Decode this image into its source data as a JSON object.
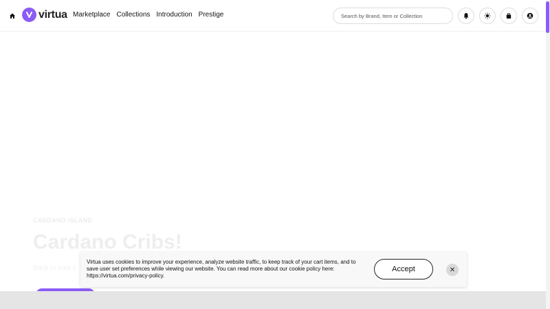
{
  "brand": {
    "name": "virtua",
    "accent": "#8b5cf6"
  },
  "nav": {
    "items": [
      "Marketplace",
      "Collections",
      "Introduction",
      "Prestige"
    ]
  },
  "search": {
    "placeholder": "Search by Brand, Item or Collection"
  },
  "header_icons": [
    "home-icon",
    "bell-icon",
    "sun-icon",
    "bag-icon",
    "user-icon"
  ],
  "hero": {
    "eyebrow": "CARDANO ISLAND",
    "title": "Cardano Cribs!",
    "subtitle": "Back to your L"
  },
  "cookie": {
    "text": "Virtua uses cookies to improve your experience, analyze website traffic, to keep track of your cart items, and to save user set preferences while viewing our website. You can read more about our cookie policy here: https://virtua.com/privacy-policy.",
    "accept_label": "Accept",
    "close_label": "✕"
  }
}
